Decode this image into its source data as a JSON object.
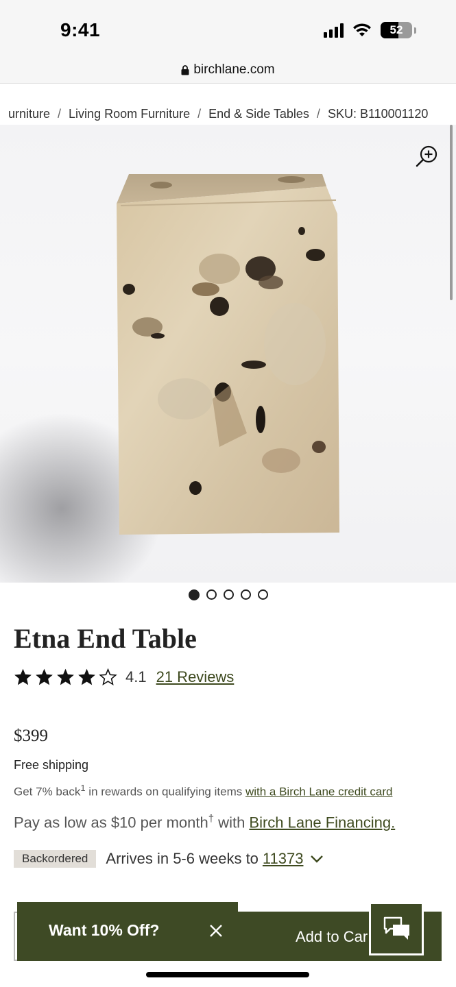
{
  "status_bar": {
    "time": "9:41",
    "battery": "52"
  },
  "browser": {
    "url": "birchlane.com"
  },
  "breadcrumb": {
    "items": [
      "urniture",
      "Living Room Furniture",
      "End & Side Tables",
      "SKU: B110001120"
    ],
    "separator": "/"
  },
  "gallery": {
    "image_count": 5,
    "active_index": 0,
    "zoom_icon": "zoom-in-icon"
  },
  "product": {
    "title": "Etna End Table",
    "rating": {
      "value": "4.1",
      "stars": 4.1,
      "max_stars": 5,
      "reviews_label": "21 Reviews"
    },
    "price": "$399",
    "shipping": "Free shipping",
    "rewards": {
      "prefix": "Get 7% back",
      "sup": "1",
      "middle": " in rewards on qualifying items ",
      "link": "with a Birch Lane credit card"
    },
    "financing": {
      "prefix": "Pay as low as $10 per month",
      "sup": "†",
      "middle": " with ",
      "link": "Birch Lane Financing."
    },
    "stock": {
      "badge": "Backordered",
      "arrival_text": "Arrives in 5-6 weeks to",
      "zip": "11373"
    }
  },
  "bottom_bar": {
    "promo_label": "Want 10% Off?",
    "cart_label": "Add to Car",
    "chat_icon": "chat-bubbles-icon"
  },
  "colors": {
    "brand_green": "#3e4a25",
    "link_green": "#3e4a1f",
    "badge_bg": "#e2ded8"
  }
}
